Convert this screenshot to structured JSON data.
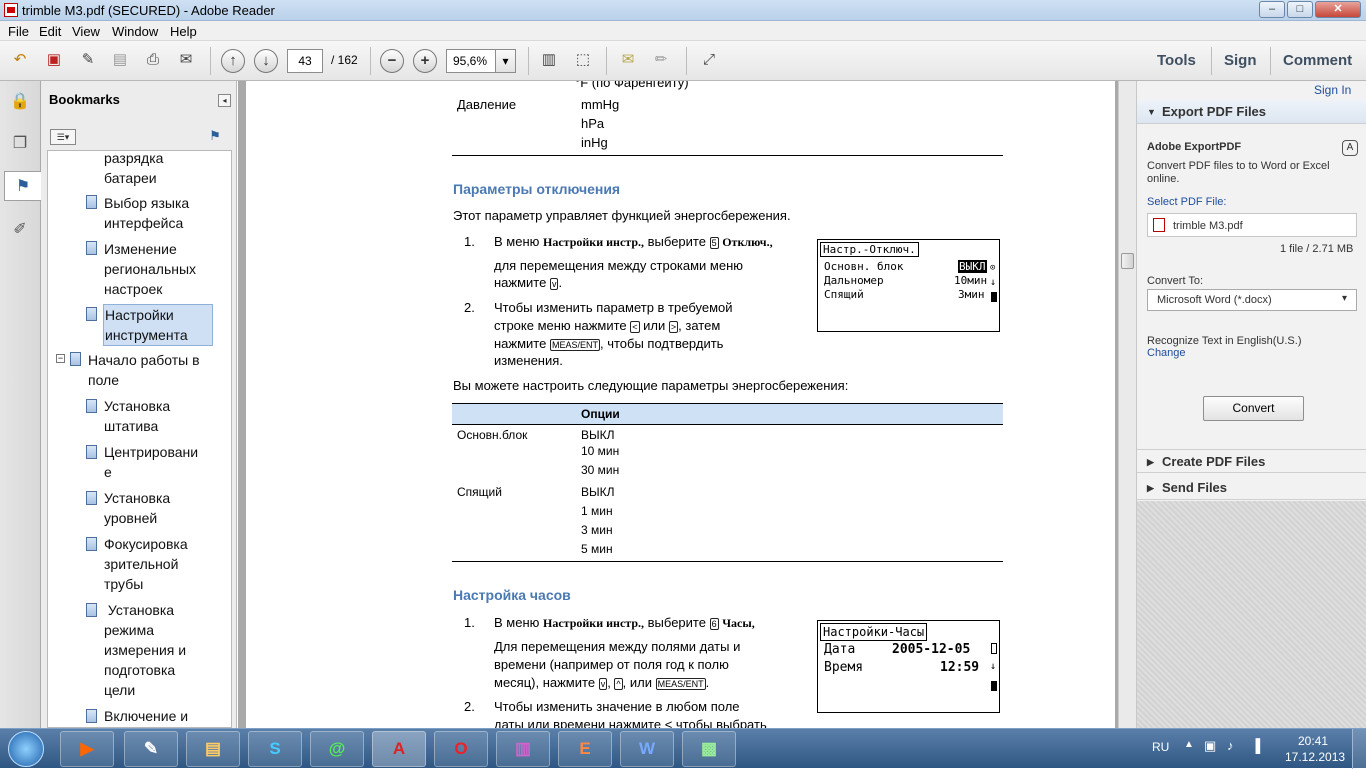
{
  "window": {
    "title": "trimble M3.pdf (SECURED) - Adobe Reader",
    "min_glyph": "–",
    "max_glyph": "□",
    "close_glyph": "✕"
  },
  "menu": [
    "File",
    "Edit",
    "View",
    "Window",
    "Help"
  ],
  "toolbar": {
    "page_current": "43",
    "page_total": "/ 162",
    "zoom": "95,6%",
    "tools_label": "Tools",
    "sign_label": "Sign",
    "comment_label": "Comment",
    "minus_glyph": "−",
    "plus_glyph": "+",
    "up_glyph": "↑",
    "down_glyph": "↓",
    "dropdown_glyph": "▾"
  },
  "bookmarks": {
    "title": "Bookmarks",
    "collapse_glyph": "◂",
    "options_glyph": "☰▾",
    "items": [
      {
        "line1": "разрядка",
        "line2": "батареи"
      },
      {
        "line1": "Выбор языка",
        "line2": "интерфейса"
      },
      {
        "line1": "Изменение",
        "line2": "региональных",
        "line3": "настроек"
      },
      {
        "line1": "Настройки",
        "line2": "инструмента"
      },
      {
        "line1": "Начало работы в",
        "line2": "поле"
      },
      {
        "line1": "Установка",
        "line2": "штатива"
      },
      {
        "line1": "Центрировани",
        "line2": "е"
      },
      {
        "line1": "Установка",
        "line2": "уровней"
      },
      {
        "line1": "Фокусировка",
        "line2": "зрительной",
        "line3": "трубы"
      },
      {
        "line1": " Установка",
        "line2": "режима",
        "line3": "измерения и",
        "line4": "подготовка",
        "line5": "цели"
      },
      {
        "line1": "Включение и"
      }
    ],
    "expander_glyph": "−"
  },
  "document": {
    "fahrenheit": "°F (по Фаренгейту)",
    "pressure_label": "Давление",
    "pressure_units": [
      "mmHg",
      "hPa",
      "inHg"
    ],
    "section1_title": "Параметры отключения",
    "section1_intro": "Этот параметр управляет функцией энергосбережения.",
    "step1_num": "1.",
    "step1_a": "В меню",
    "step1_menu": "Настройки инстр.,",
    "step1_b": "выберите",
    "step1_key": "5",
    "step1_option": "Отключ.,",
    "step1_line2": "для перемещения между строками меню",
    "step1_line3": "нажмите",
    "step1_key2": "v",
    "step2_num": "2.",
    "step2_line1": "Чтобы изменить параметр в требуемой",
    "step2_line2a": "строке меню нажмите",
    "step2_key_left": "<",
    "step2_or": "или",
    "step2_key_right": ">",
    "step2_then": ", затем",
    "step2_line3a": "нажмите",
    "step2_meas": "MEAS/ENT",
    "step2_line3b": ", чтобы подтвердить",
    "step2_line4": "изменения.",
    "lcd1": {
      "title": "Настр.-Отключ.",
      "row1_label": "Основн. блок",
      "row1_value": "ВЫКЛ",
      "row2_label": "Дальномер",
      "row2_value": "10мин",
      "row3_label": "Спящий",
      "row3_value": "3мин"
    },
    "params_intro": "Вы можете настроить следующие параметры энергосбережения:",
    "table_header": "Опции",
    "table_rows": [
      {
        "label": "Основн.блок",
        "options": [
          "ВЫКЛ",
          "10 мин",
          "30 мин"
        ]
      },
      {
        "label": "Спящий",
        "options": [
          "ВЫКЛ",
          "1 мин",
          "3 мин",
          "5 мин"
        ]
      }
    ],
    "section2_title": "Настройка часов",
    "c_step1_num": "1.",
    "c_step1_a": "В меню",
    "c_step1_menu": "Настройки инстр.,",
    "c_step1_b": "выберите",
    "c_step1_key": "6",
    "c_step1_option": "Часы,",
    "c_line2": "Для перемещения между полями даты и",
    "c_line3": "времени (например от поля год к полю",
    "c_line4a": "месяц), нажмите",
    "c_key_v": "v",
    "c_key_up": "^",
    "c_line4b": ", или",
    "c_meas": "MEAS/ENT",
    "c_step2_num": "2.",
    "c_step2_line1": "Чтобы изменить значение в любом поле",
    "c_step2_line2": "даты или времени нажмите < чтобы выбрать",
    "lcd2": {
      "title": "Настройки-Часы",
      "date_label": "Дата",
      "date_value": "2005-12-05",
      "time_label": "Время",
      "time_value": "12:59"
    }
  },
  "rightpanel": {
    "signin": "Sign In",
    "export_title": "Export PDF Files",
    "service_name": "Adobe ExportPDF",
    "service_desc1": "Convert PDF files to to Word or Excel",
    "service_desc2": "online.",
    "select_label": "Select PDF File:",
    "file_name": "trimble M3.pdf",
    "file_info": "1 file / 2.71 MB",
    "convert_to_label": "Convert To:",
    "convert_to_value": "Microsoft Word (*.docx)",
    "recognize_text": "Recognize Text in English(U.S.)",
    "change_link": "Change",
    "convert_button": "Convert",
    "create_title": "Create PDF Files",
    "send_title": "Send Files",
    "tri_down": "▼",
    "tri_right": "▶"
  },
  "taskbar": {
    "lang": "RU",
    "time": "20:41",
    "date": "17.12.2013",
    "apps": [
      "▶",
      "✎",
      "▤",
      "S",
      "@",
      "A",
      "O",
      "▥",
      "E",
      "W",
      "▩"
    ]
  }
}
